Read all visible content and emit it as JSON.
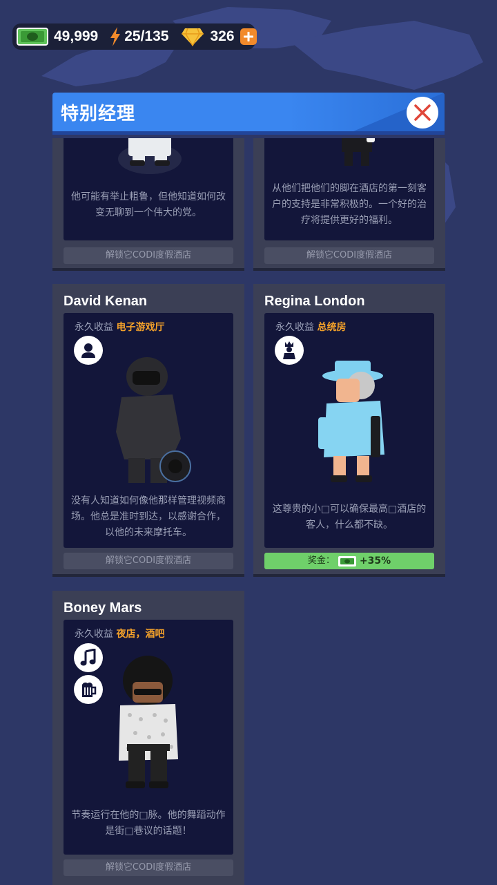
{
  "resources": {
    "cash": "49,999",
    "energy": "25/135",
    "gems": "326"
  },
  "header": {
    "title": "特别经理"
  },
  "cards_top": [
    {
      "description": "他可能有举止粗鲁，但他知道如何改变无聊到一个伟大的党。",
      "unlock_label": "解锁它CODI度假酒店"
    },
    {
      "description": "从他们把他们的脚在酒店的第一刻客户的支持是非常积极的。一个好的治疗将提供更好的福利。",
      "unlock_label": "解锁它CODI度假酒店"
    }
  ],
  "cards": [
    {
      "name": "David Kenan",
      "income_label": "永久收益",
      "business": "电子游戏厅",
      "icons": [
        "person-icon"
      ],
      "description": "没有人知道如何像他那样管理视频商场。他总是准时到达，以感谢合作，以他的未来摩托车。",
      "unlock_label": "解锁它CODI度假酒店"
    },
    {
      "name": "Regina London",
      "income_label": "永久收益",
      "business": "总统房",
      "icons": [
        "king-icon"
      ],
      "description": "这尊贵的小□可以确保最高□酒店的客人，什么都不缺。",
      "bonus_label": "奖金：",
      "bonus_value": "+35%"
    },
    {
      "name": "Boney Mars",
      "income_label": "永久收益",
      "business": "夜店，酒吧",
      "icons": [
        "music-note-icon",
        "beer-mug-icon"
      ],
      "description": "节奏运行在他的□脉。他的舞蹈动作是街□巷议的话题！",
      "unlock_label": "解锁它CODI度假酒店"
    }
  ],
  "colors": {
    "background": "#2d3766",
    "banner": "#3a86f0",
    "card": "#3b3f55",
    "card_inner": "#13163a",
    "business_text": "#f3a12a",
    "bonus_bar": "#6fd06a"
  }
}
